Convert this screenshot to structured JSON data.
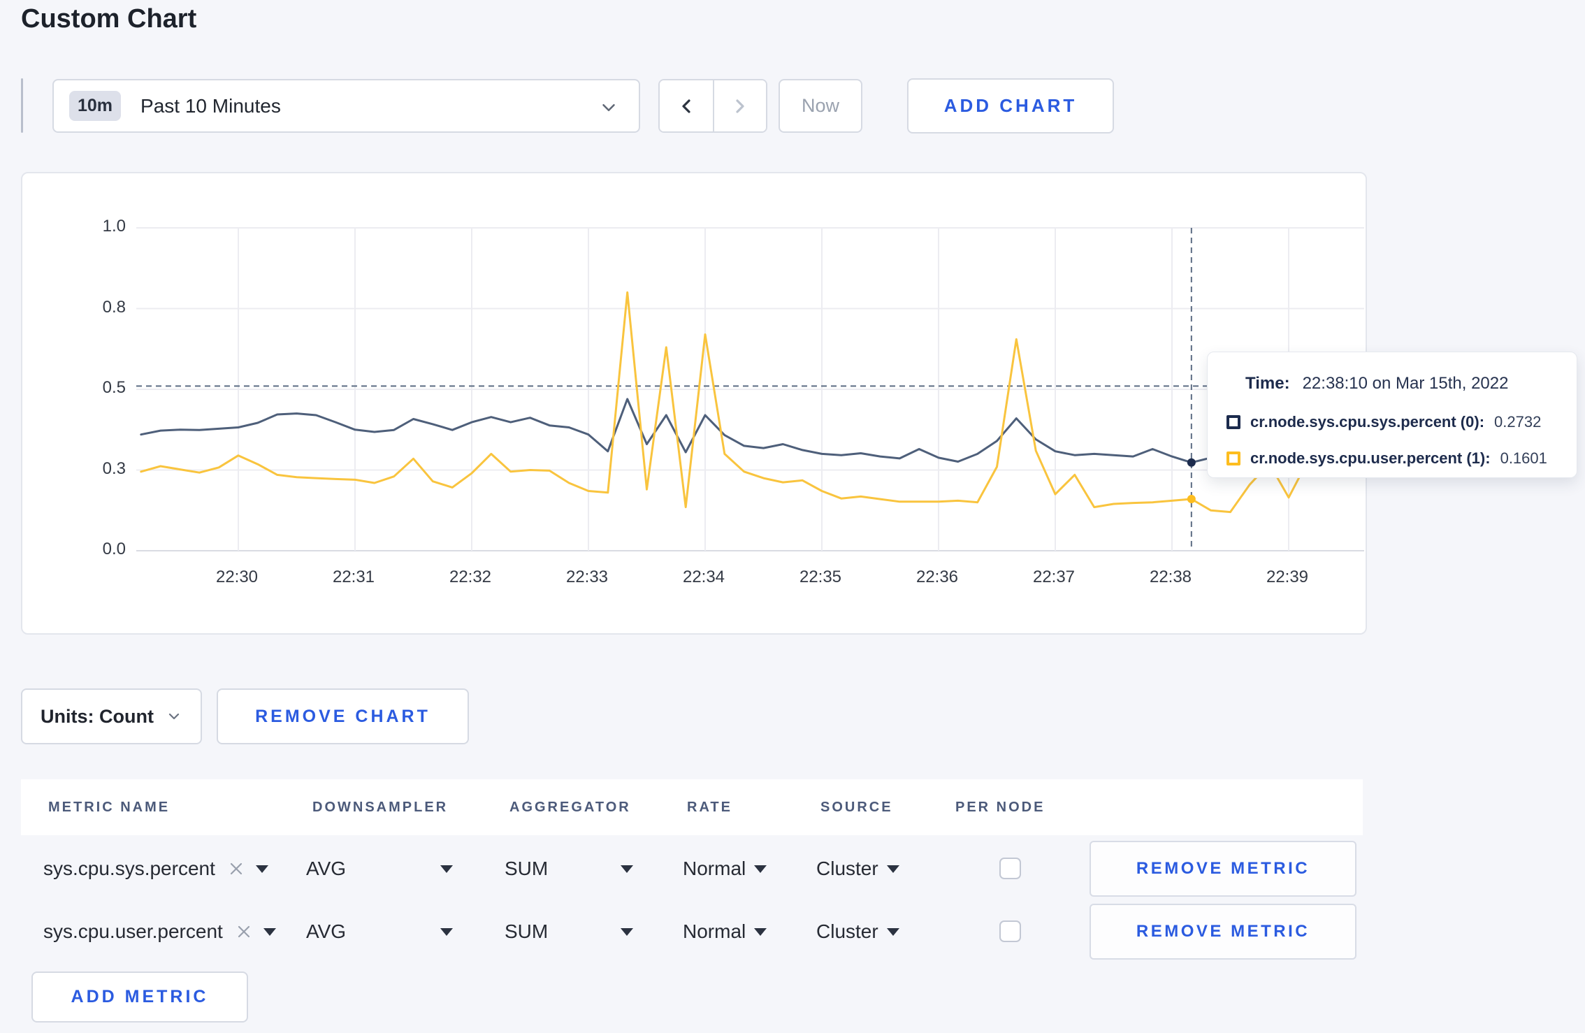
{
  "page": {
    "title": "Custom Chart",
    "background": "#f5f6fa",
    "accent_blue": "#2b5be0"
  },
  "toolbar": {
    "time_range_badge": "10m",
    "time_range_label": "Past 10 Minutes",
    "now_label": "Now",
    "add_chart_label": "ADD CHART"
  },
  "chart_data": {
    "type": "line",
    "title": "",
    "xlabel": "",
    "ylabel": "",
    "x_start": "22:29:10",
    "x_interval_seconds": 10,
    "x_ticks": [
      "22:30",
      "22:31",
      "22:32",
      "22:33",
      "22:34",
      "22:35",
      "22:36",
      "22:37",
      "22:38",
      "22:39"
    ],
    "y_ticks": [
      {
        "label": "0.0",
        "value": 0
      },
      {
        "label": "0.3",
        "value": 0.25
      },
      {
        "label": "0.5",
        "value": 0.5
      },
      {
        "label": "0.8",
        "value": 0.75
      },
      {
        "label": "1.0",
        "value": 1.0
      }
    ],
    "ylim": [
      0,
      1
    ],
    "grid": true,
    "legend_position": "tooltip",
    "crosshair": {
      "index": 54,
      "time": "22:38:10",
      "y_value": 0.51
    },
    "colors": {
      "grid": "#ececf1",
      "axis_line": "#d9dbe2",
      "crosshair": "#5c6c83"
    },
    "series": [
      {
        "name": "cr.node.sys.cpu.sys.percent",
        "color": "#4e5f7a",
        "marker_color": "#1c2b4d",
        "values": [
          0.36,
          0.372,
          0.375,
          0.374,
          0.378,
          0.382,
          0.396,
          0.422,
          0.425,
          0.42,
          0.398,
          0.375,
          0.368,
          0.374,
          0.408,
          0.392,
          0.374,
          0.398,
          0.414,
          0.398,
          0.412,
          0.388,
          0.382,
          0.36,
          0.308,
          0.47,
          0.33,
          0.42,
          0.305,
          0.42,
          0.358,
          0.325,
          0.318,
          0.33,
          0.312,
          0.3,
          0.296,
          0.302,
          0.292,
          0.286,
          0.315,
          0.288,
          0.276,
          0.3,
          0.34,
          0.41,
          0.345,
          0.308,
          0.296,
          0.3,
          0.296,
          0.292,
          0.315,
          0.292,
          0.2732,
          0.288,
          0.3,
          0.31,
          0.302,
          0.296,
          0.306,
          0.31,
          0.3,
          0.305
        ]
      },
      {
        "name": "cr.node.sys.cpu.user.percent",
        "color": "#f9c43e",
        "marker_color": "#fdbd1f",
        "values": [
          0.245,
          0.262,
          0.252,
          0.242,
          0.258,
          0.295,
          0.268,
          0.235,
          0.228,
          0.225,
          0.222,
          0.22,
          0.21,
          0.23,
          0.285,
          0.215,
          0.196,
          0.24,
          0.3,
          0.245,
          0.25,
          0.248,
          0.21,
          0.185,
          0.18,
          0.8,
          0.19,
          0.63,
          0.135,
          0.67,
          0.3,
          0.245,
          0.225,
          0.212,
          0.218,
          0.185,
          0.162,
          0.168,
          0.16,
          0.152,
          0.152,
          0.152,
          0.155,
          0.15,
          0.26,
          0.655,
          0.31,
          0.175,
          0.235,
          0.135,
          0.145,
          0.148,
          0.15,
          0.155,
          0.1601,
          0.125,
          0.12,
          0.205,
          0.27,
          0.165,
          0.28,
          0.27,
          0.262,
          0.27
        ]
      }
    ]
  },
  "tooltip": {
    "time_label": "Time:",
    "time_value": "22:38:10 on Mar 15th, 2022",
    "entries": [
      {
        "name": "cr.node.sys.cpu.sys.percent (0):",
        "value": "0.2732",
        "color": "#1c2b4d"
      },
      {
        "name": "cr.node.sys.cpu.user.percent (1):",
        "value": "0.1601",
        "color": "#fdbd1f"
      }
    ]
  },
  "chart_footer": {
    "units_label": "Units: Count",
    "remove_chart_label": "REMOVE CHART"
  },
  "metrics_table": {
    "headers": [
      "METRIC NAME",
      "DOWNSAMPLER",
      "AGGREGATOR",
      "RATE",
      "SOURCE",
      "PER NODE"
    ],
    "rows": [
      {
        "metric": "sys.cpu.sys.percent",
        "downsampler": "AVG",
        "aggregator": "SUM",
        "rate": "Normal",
        "source": "Cluster",
        "per_node_checked": false,
        "remove_label": "REMOVE METRIC"
      },
      {
        "metric": "sys.cpu.user.percent",
        "downsampler": "AVG",
        "aggregator": "SUM",
        "rate": "Normal",
        "source": "Cluster",
        "per_node_checked": false,
        "remove_label": "REMOVE METRIC"
      }
    ],
    "add_metric_label": "ADD METRIC"
  }
}
